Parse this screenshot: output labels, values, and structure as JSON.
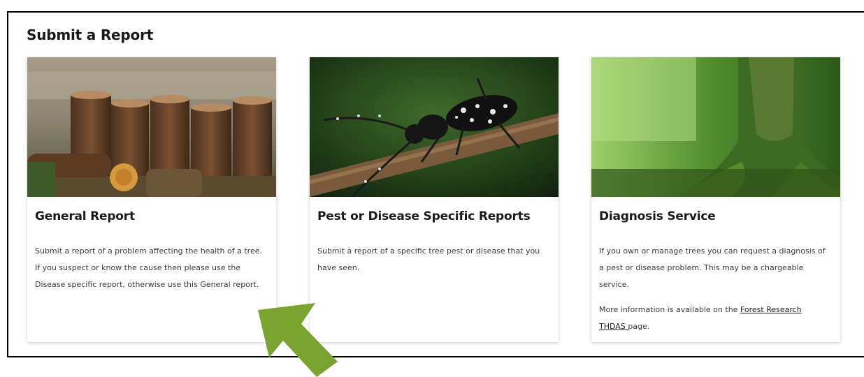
{
  "page": {
    "title": "Submit a Report"
  },
  "cards": [
    {
      "title": "General Report",
      "description": "Submit a report of a problem affecting the health of a tree. If you suspect or know the cause then please use the Disease specific report, otherwise use this General report."
    },
    {
      "title": "Pest or Disease Specific Reports",
      "description": "Submit a report of a specific tree pest or disease that you have seen."
    },
    {
      "title": "Diagnosis Service",
      "description": "If you own or manage trees you can request a diagnosis of a pest or disease problem. This may be a chargeable service.",
      "more_prefix": "More information is available on the ",
      "more_link": "Forest Research THDAS ",
      "more_suffix": "page."
    }
  ],
  "images": {
    "card1": "cut-log-stumps-photo",
    "card2": "longhorn-beetle-on-branch-photo",
    "card3": "mossy-tree-roots-photo"
  },
  "colors": {
    "arrow": "#7aa332",
    "border": "#000000"
  },
  "icons": {
    "annotation": "arrow-up-left-icon"
  }
}
